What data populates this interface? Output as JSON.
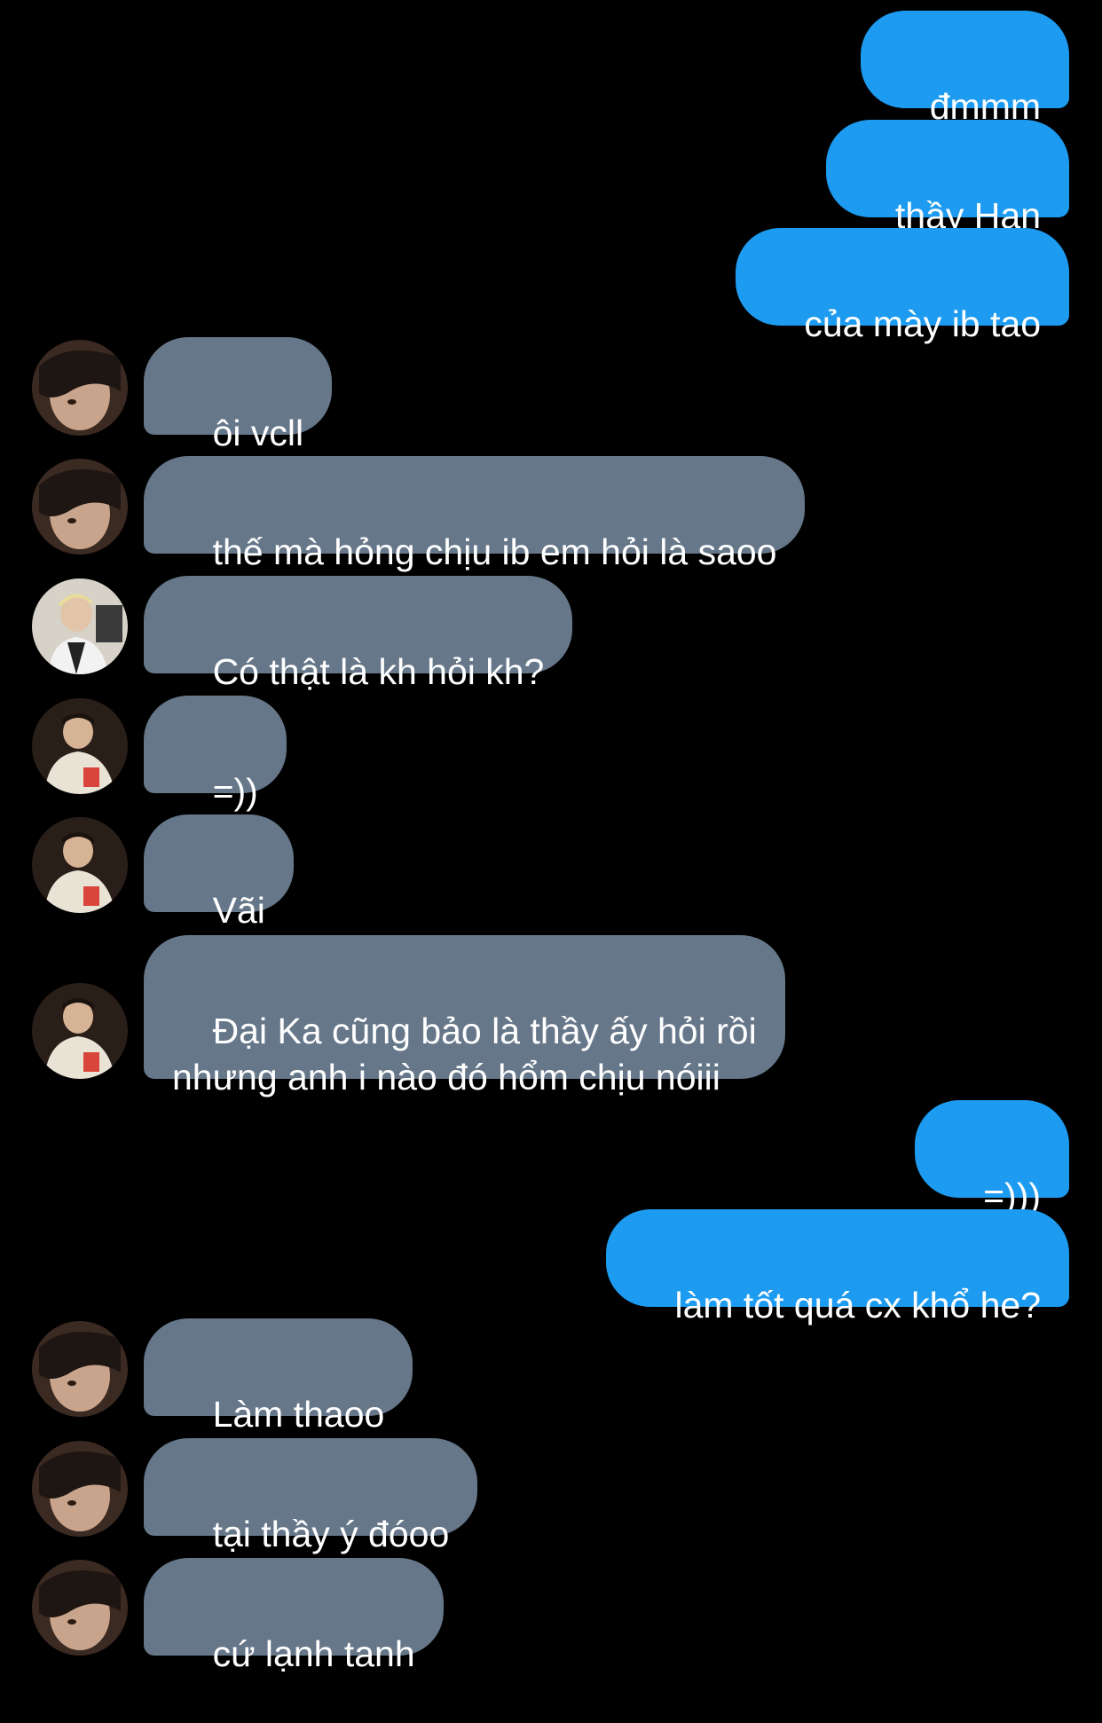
{
  "conversation": {
    "messages": [
      {
        "id": "m1",
        "side": "out",
        "text": "đmmm"
      },
      {
        "id": "m2",
        "side": "out",
        "text": "thầy Han"
      },
      {
        "id": "m3",
        "side": "out",
        "text": "của mày ib tao"
      },
      {
        "id": "m4",
        "side": "in",
        "avatar": "avatar-a-icon",
        "text": "ôi vcll"
      },
      {
        "id": "m5",
        "side": "in",
        "avatar": "avatar-a-icon",
        "text": "thế mà hỏng chịu ib em hỏi là saoo"
      },
      {
        "id": "m6",
        "side": "in",
        "avatar": "avatar-b-icon",
        "text": "Có thật là kh hỏi kh?"
      },
      {
        "id": "m7",
        "side": "in",
        "avatar": "avatar-c-icon",
        "text": "=))"
      },
      {
        "id": "m8",
        "side": "in",
        "avatar": "avatar-c-icon",
        "text": "Vãi"
      },
      {
        "id": "m9",
        "side": "in",
        "avatar": "avatar-c-icon",
        "text": "Đại Ka cũng bảo là thầy ấy hỏi rồi\nnhưng anh i nào đó hổm chịu nóiii"
      },
      {
        "id": "m10",
        "side": "out",
        "text": "=)))"
      },
      {
        "id": "m11",
        "side": "out",
        "text": "làm tốt quá cx khổ he?"
      },
      {
        "id": "m12",
        "side": "in",
        "avatar": "avatar-a-icon",
        "text": "Làm thaoo"
      },
      {
        "id": "m13",
        "side": "in",
        "avatar": "avatar-a-icon",
        "text": "tại thầy ý đóoo"
      },
      {
        "id": "m14",
        "side": "in",
        "avatar": "avatar-a-icon",
        "text": "cứ lạnh tanh"
      }
    ]
  },
  "colors": {
    "background": "#000000",
    "outgoing_bubble": "#1d9bf0",
    "incoming_bubble": "#66778a",
    "text": "#ffffff"
  }
}
